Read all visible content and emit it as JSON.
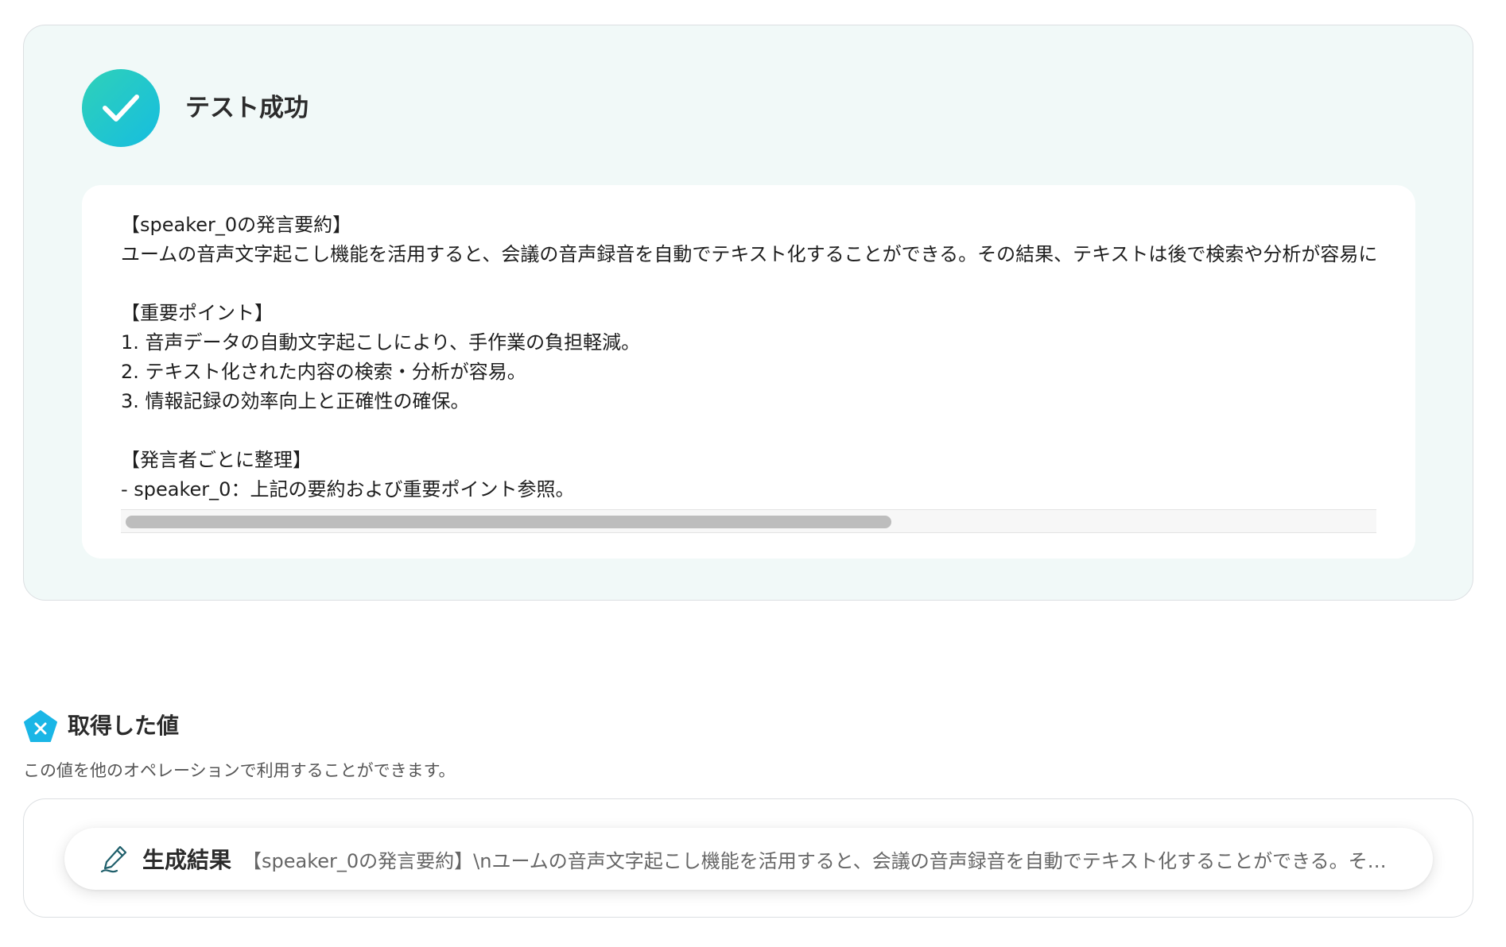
{
  "test_result": {
    "status_title": "テスト成功",
    "status_icon": "check-icon",
    "accent_gradient": [
      "#2fd1b8",
      "#16bde0"
    ],
    "output_lines": [
      "【speaker_0の発言要約】",
      "ユームの音声文字起こし機能を活用すると、会議の音声録音を自動でテキスト化することができる。その結果、テキストは後で検索や分析が容易に",
      "",
      "【重要ポイント】",
      "1. 音声データの自動文字起こしにより、手作業の負担軽減。",
      "2. テキスト化された内容の検索・分析が容易。",
      "3. 情報記録の効率向上と正確性の確保。",
      "",
      "【発言者ごとに整理】",
      "- speaker_0：上記の要約および重要ポイント参照。"
    ]
  },
  "retrieved_values": {
    "title": "取得した値",
    "icon": "pentagon-x-icon",
    "description": "この値を他のオペレーションで利用することができます。",
    "items": [
      {
        "icon": "pen-icon",
        "name": "生成結果",
        "preview": "【speaker_0の発言要約】\\nユームの音声文字起こし機能を活用すると、会議の音声録音を自動でテキスト化することができる。その結..."
      }
    ]
  }
}
